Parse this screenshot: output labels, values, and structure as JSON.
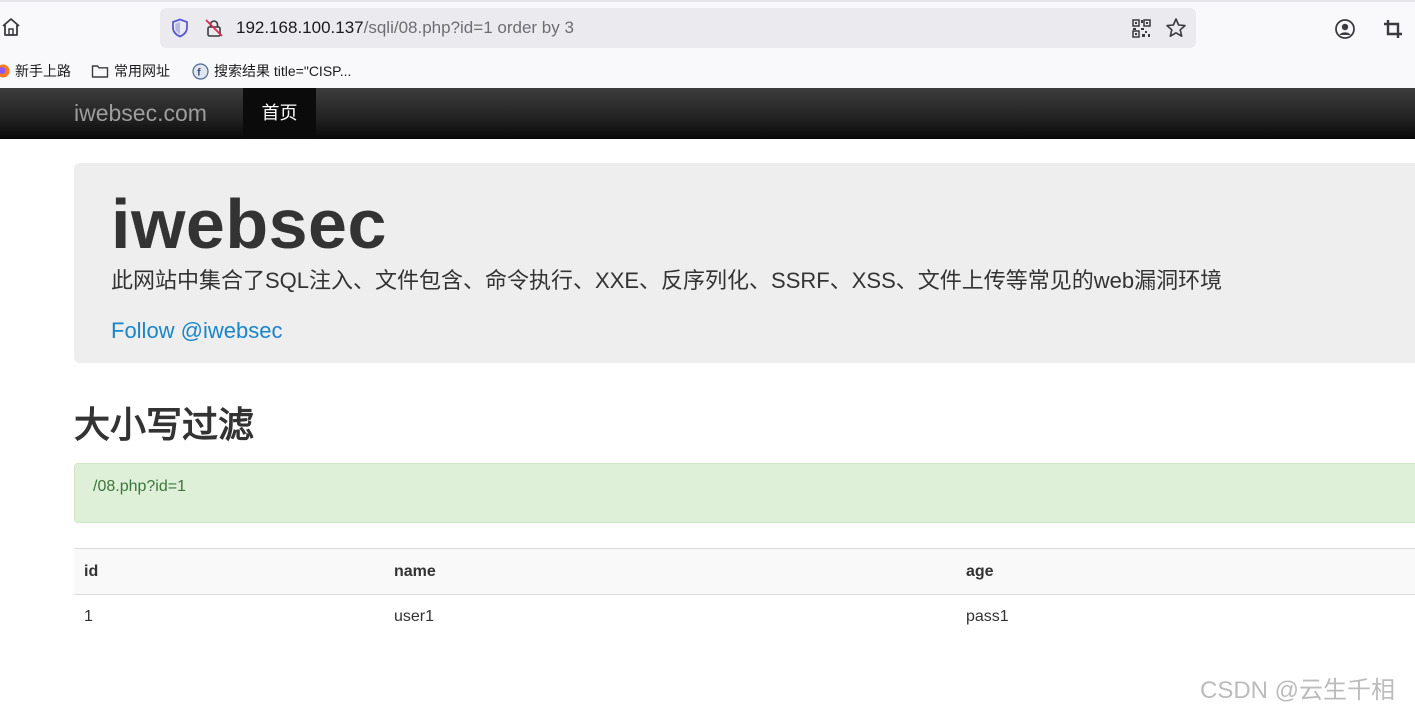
{
  "browser": {
    "url_host": "192.168.100.137",
    "url_path": "/sqli/08.php?id=1 order by 3",
    "bookmarks": [
      {
        "label": "新手上路",
        "icon": "firefox-icon"
      },
      {
        "label": "常用网址",
        "icon": "folder-icon"
      },
      {
        "label": "搜索结果 title=\"CISP...",
        "icon": "site-favicon-icon"
      }
    ]
  },
  "navbar": {
    "brand": "iwebsec.com",
    "home": "首页"
  },
  "jumbotron": {
    "title": "iwebsec",
    "description": "此网站中集合了SQL注入、文件包含、命令执行、XXE、反序列化、SSRF、XSS、文件上传等常见的web漏洞环境",
    "follow": "Follow @iwebsec"
  },
  "section": {
    "title": "大小写过滤",
    "alert": "/08.php?id=1"
  },
  "table": {
    "headers": [
      "id",
      "name",
      "age"
    ],
    "rows": [
      [
        "1",
        "user1",
        "pass1"
      ]
    ]
  },
  "watermark": "CSDN @云生千相",
  "colors": {
    "link": "#1a86c9",
    "alert_bg": "#dff0d8",
    "alert_text": "#3c763d",
    "navbar_bg": "#222222"
  }
}
